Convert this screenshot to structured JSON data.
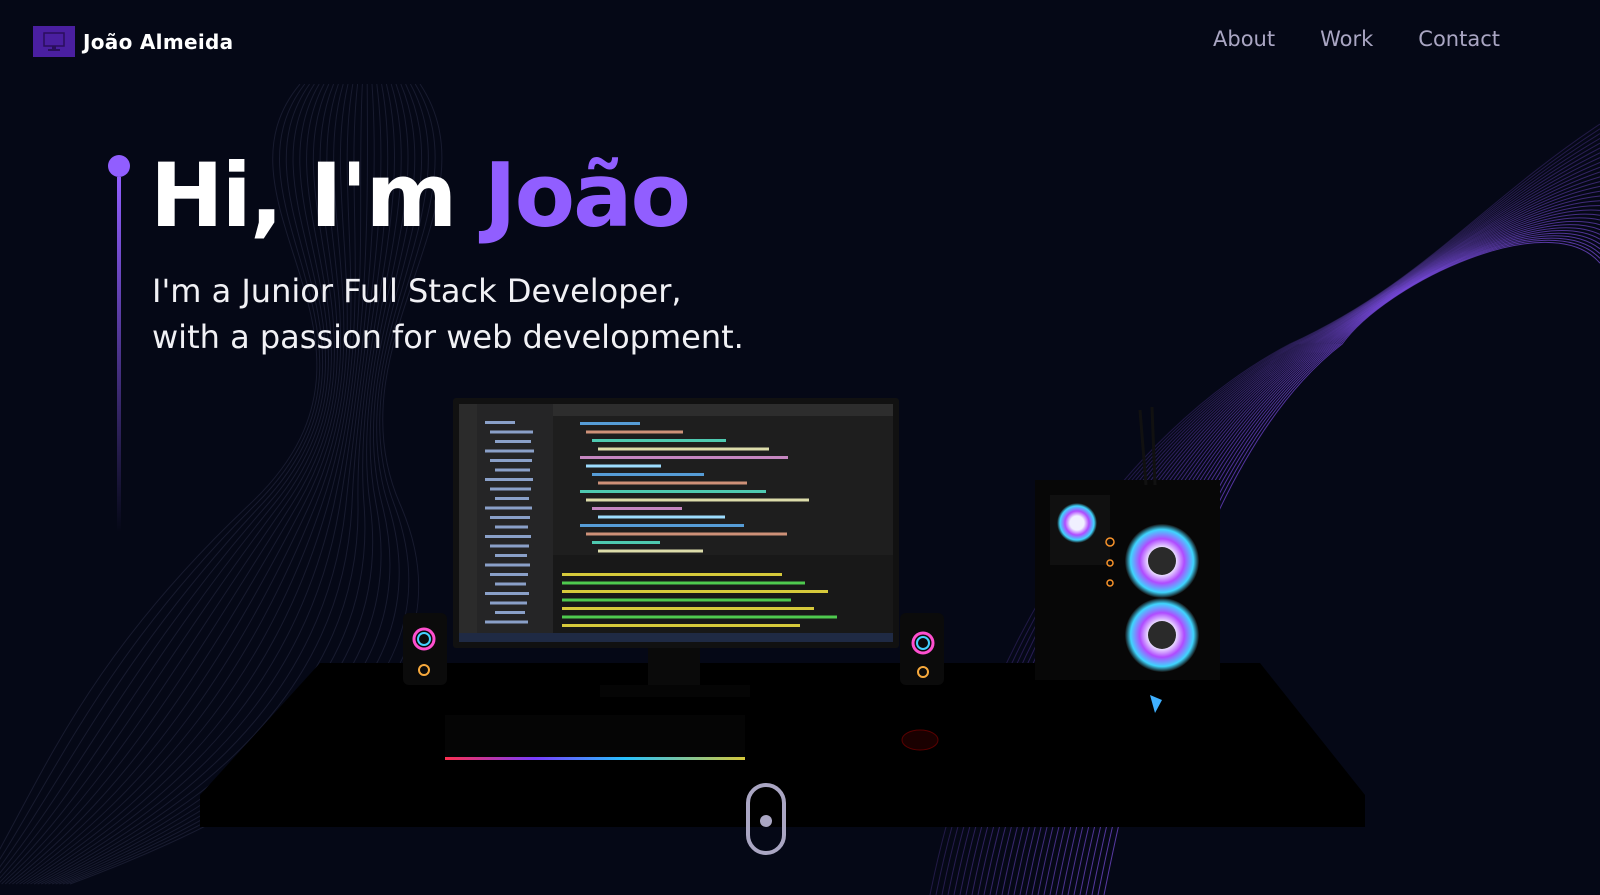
{
  "nav": {
    "brand_name": "João Almeida",
    "links": [
      "About",
      "Work",
      "Contact"
    ]
  },
  "hero": {
    "greeting": "Hi, I'm ",
    "name": "João",
    "subtitle_line1": "I'm a Junior Full Stack Developer,",
    "subtitle_line2": "with a passion for web development."
  },
  "colors": {
    "background": "#050816",
    "accent": "#915eff",
    "nav_text": "#aaa6c3",
    "white": "#ffffff"
  },
  "icons": {
    "logo": "computer-icon",
    "scroll": "mouse-scroll-icon"
  }
}
